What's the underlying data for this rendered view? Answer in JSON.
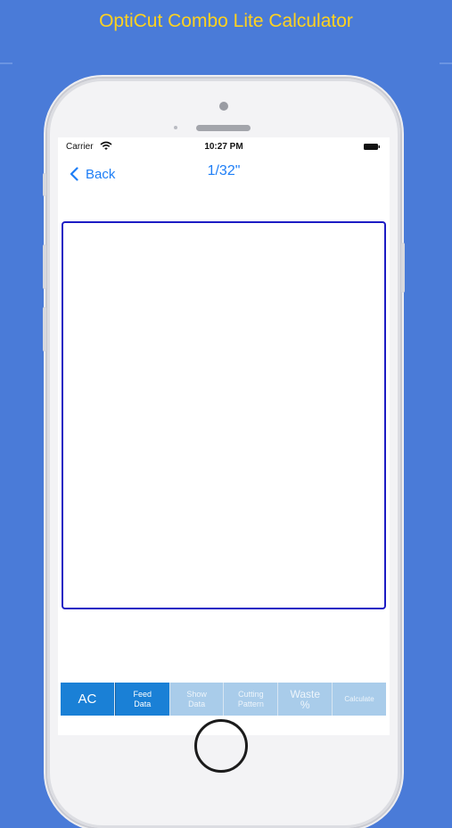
{
  "promo": {
    "title": "OptiCut Combo Lite Calculator"
  },
  "status_bar": {
    "carrier": "Carrier",
    "time": "10:27 PM"
  },
  "nav": {
    "back_label": "Back",
    "title": "1/32\""
  },
  "toolbar": {
    "ac": "AC",
    "feed_data": "Feed\nData",
    "show_data": "Show\nData",
    "cutting_pattern": "Cutting\nPattern",
    "waste": "Waste\n%",
    "calculate": "Calculate"
  },
  "colors": {
    "background": "#4a7bd8",
    "promo_text": "#ffd21f",
    "accent": "#1e7ef6",
    "canvas_border": "#1d1cc4",
    "toolbar_active": "#1a80d6",
    "toolbar_inactive": "#a9ccea"
  },
  "icons": [
    "wifi-icon",
    "battery-icon",
    "chevron-left-icon"
  ]
}
